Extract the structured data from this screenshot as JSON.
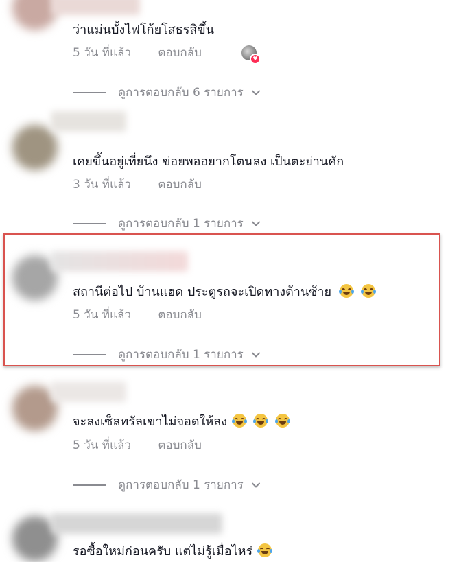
{
  "comments": [
    {
      "text": "ว่าแม่นบั้งไฟโก้ยโสธรสิขึ้น",
      "time": "5 วัน ที่แล้ว",
      "reply": "ตอบกลับ",
      "view_replies": "ดูการตอบกลับ 6 รายการ",
      "emojis": 0
    },
    {
      "text": "เคยขึ้นอยู่เที่ยนึง ข่อยพออยากโตนลง เป็นตะย่านคัก",
      "time": "3 วัน ที่แล้ว",
      "reply": "ตอบกลับ",
      "view_replies": "ดูการตอบกลับ 1 รายการ",
      "emojis": 0
    },
    {
      "text": "สถานีต่อไป บ้านแฮด ประตูรถจะเปิดทางด้านซ้าย",
      "time": "5 วัน ที่แล้ว",
      "reply": "ตอบกลับ",
      "view_replies": "ดูการตอบกลับ 1 รายการ",
      "emojis": 2
    },
    {
      "text": "จะลงเซ็ลทรัลเขาไม่จอดให้ลง",
      "time": "5 วัน ที่แล้ว",
      "reply": "ตอบกลับ",
      "view_replies": "ดูการตอบกลับ 1 รายการ",
      "emojis": 3
    },
    {
      "text": "รอซื้อใหม่ก่อนครับ แต่ไม่รู้เมื่อไหร่",
      "emojis": 1
    }
  ],
  "colors": {
    "text": "#161823",
    "secondary": "#8a8b91",
    "highlight_border": "#d9534f",
    "like_heart": "#fe2c55"
  },
  "icons": {
    "reaction_emoji": "rolling-laughing-emoji",
    "expand": "chevron-down-icon"
  }
}
